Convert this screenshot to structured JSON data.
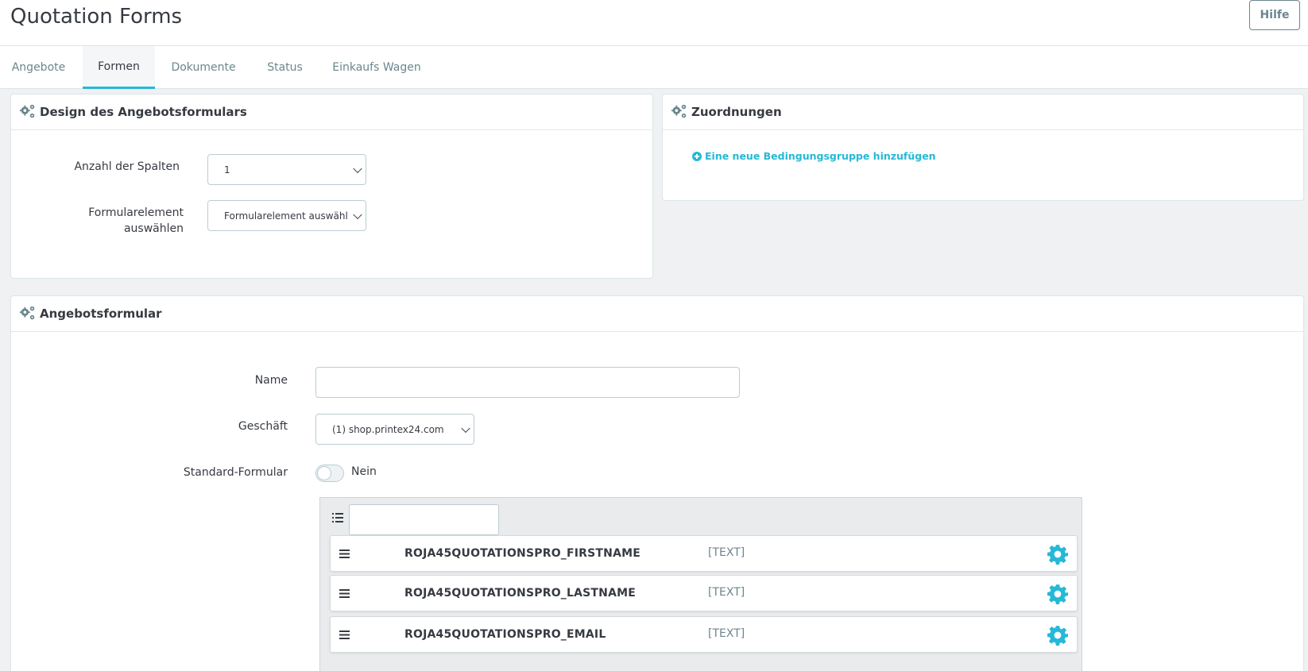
{
  "header": {
    "title": "Quotation Forms",
    "help_label": "Hilfe"
  },
  "tabs": [
    {
      "label": "Angebote",
      "active": false
    },
    {
      "label": "Formen",
      "active": true
    },
    {
      "label": "Dokumente",
      "active": false
    },
    {
      "label": "Status",
      "active": false
    },
    {
      "label": "Einkaufs Wagen",
      "active": false
    }
  ],
  "design_panel": {
    "title": "Design des Angebotsformulars",
    "columns_label": "Anzahl der Spalten",
    "columns_value": "1",
    "element_label_line1": "Formularelement",
    "element_label_line2": "auswählen",
    "element_value": "Formularelement auswähl"
  },
  "assign_panel": {
    "title": "Zuordnungen",
    "add_link": "Eine neue Bedingungsgruppe hinzufügen"
  },
  "form_panel": {
    "title": "Angebotsformular",
    "name_label": "Name",
    "name_value": "",
    "shop_label": "Geschäft",
    "shop_value": "(1) shop.printex24.com",
    "default_label": "Standard-Formular",
    "default_value": "Nein",
    "default_on": false,
    "fields": [
      {
        "name": "ROJA45QUOTATIONSPRO_FIRSTNAME",
        "type": "[TEXT]"
      },
      {
        "name": "ROJA45QUOTATIONSPRO_LASTNAME",
        "type": "[TEXT]"
      },
      {
        "name": "ROJA45QUOTATIONSPRO_EMAIL",
        "type": "[TEXT]"
      }
    ]
  },
  "colors": {
    "accent": "#25b9d7",
    "background": "#eff1f2",
    "text": "#363a41",
    "muted": "#6c868e"
  }
}
